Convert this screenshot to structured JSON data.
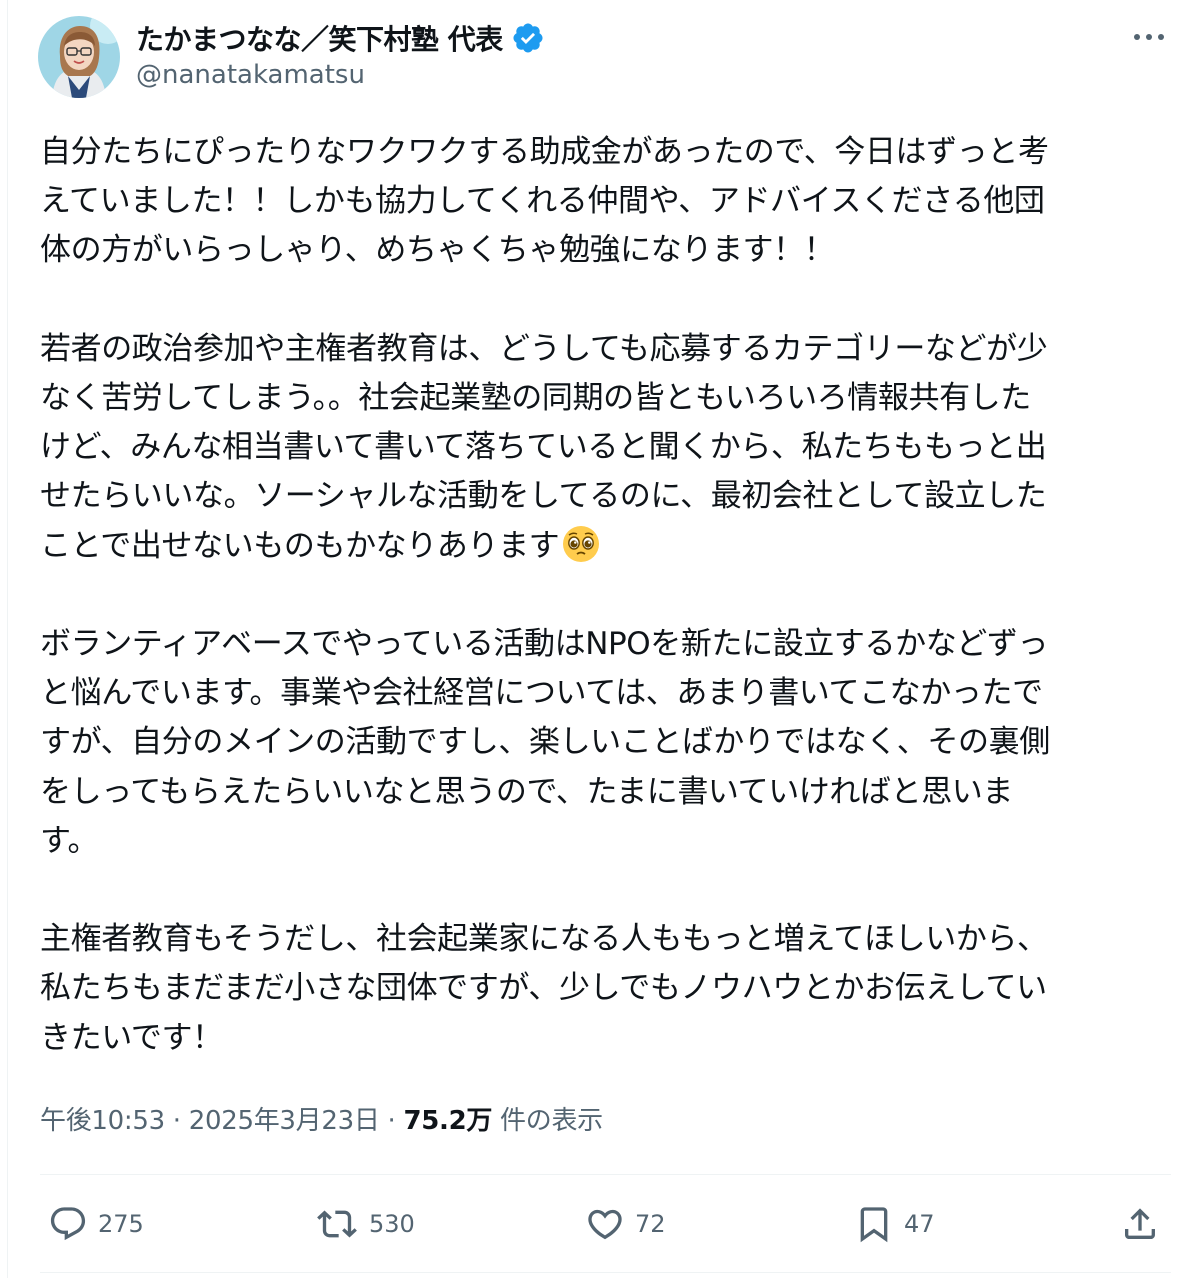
{
  "author": {
    "display_name": "たかまつなな／笑下村塾 代表",
    "handle": "@nanatakamatsu",
    "avatar_icon": "profile-photo",
    "verified_icon": "verified-badge-icon",
    "verified_color": "#1d9bf0"
  },
  "tweet": {
    "paragraphs": [
      {
        "lines": [
          "自分たちにぴったりなワクワクする助成金があったので、今日はずっと考",
          "えていました！！しかも協力してくれる仲間や、アドバイスくださる他団",
          "体の方がいらっしゃり、めちゃくちゃ勉強になります！！"
        ]
      },
      {
        "lines": [
          "若者の政治参加や主権者教育は、どうしても応募するカテゴリーなどが少",
          "なく苦労してしまう。。社会起業塾の同期の皆ともいろいろ情報共有した",
          "けど、みんな相当書いて書いて落ちていると聞くから、私たちももっと出",
          "せたらいいな。ソーシャルな活動をしてるのに、最初会社として設立した"
        ],
        "last_line": "ことで出せないものもかなりあります",
        "last_line_emoji": "pleading-face-emoji"
      },
      {
        "lines": [
          "ボランティアベースでやっている活動はNPOを新たに設立するかなどずっ",
          "と悩んでいます。事業や会社経営については、あまり書いてこなかったで",
          "すが、自分のメインの活動ですし、楽しいことばかりではなく、その裏側",
          "をしってもらえたらいいなと思うので、たまに書いていければと思いま",
          "す。"
        ]
      },
      {
        "lines": [
          "主権者教育もそうだし、社会起業家になる人ももっと増えてほしいから、",
          "私たちもまだまだ小さな団体ですが、少しでもノウハウとかお伝えしてい",
          "きたいです！"
        ]
      }
    ]
  },
  "meta": {
    "time": "午後10:53",
    "separator": " · ",
    "date": "2025年3月23日",
    "views_count": "75.2万",
    "views_label": " 件の表示"
  },
  "actions": {
    "reply_count": "275",
    "repost_count": "530",
    "like_count": "72",
    "bookmark_count": "47"
  },
  "colors": {
    "text_primary": "#0f1419",
    "text_secondary": "#536471",
    "divider": "#eff3f4",
    "accent": "#1d9bf0"
  }
}
